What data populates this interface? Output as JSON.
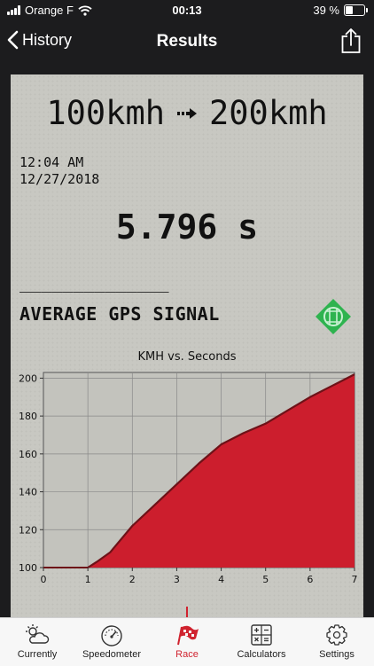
{
  "status_bar": {
    "carrier": "Orange F",
    "time": "00:13",
    "battery": "39 %"
  },
  "nav": {
    "back_label": "History",
    "title": "Results"
  },
  "result": {
    "speed_from": "100kmh",
    "speed_to": "200kmh",
    "time": "12:04 AM",
    "date": "12/27/2018",
    "elapsed": "5.796 s",
    "divider": "______________",
    "signal_label": "AVERAGE GPS SIGNAL"
  },
  "chart_data": {
    "type": "area",
    "title": "KMH vs. Seconds",
    "xlim": [
      0,
      7
    ],
    "ylim": [
      100,
      203
    ],
    "x_ticks": [
      0,
      1,
      2,
      3,
      4,
      5,
      6,
      7
    ],
    "y_ticks": [
      100,
      120,
      140,
      160,
      180,
      200
    ],
    "grid": true,
    "fill_color": "#cc1e2d",
    "line_color": "#6e1218",
    "x": [
      1.0,
      1.2,
      1.5,
      2.0,
      2.5,
      3.0,
      3.5,
      4.0,
      4.5,
      5.0,
      5.5,
      6.0,
      6.5,
      7.0
    ],
    "y": [
      100,
      103,
      108,
      122,
      133,
      144,
      155,
      165,
      171,
      176,
      183,
      190,
      196,
      202
    ]
  },
  "tabs": [
    {
      "label": "Currently",
      "icon": "weather-icon",
      "active": false
    },
    {
      "label": "Speedometer",
      "icon": "speedometer-icon",
      "active": false
    },
    {
      "label": "Race",
      "icon": "race-flag-icon",
      "active": true
    },
    {
      "label": "Calculators",
      "icon": "calculator-icon",
      "active": false
    },
    {
      "label": "Settings",
      "icon": "gear-icon",
      "active": false
    }
  ],
  "colors": {
    "accent": "#d0232f",
    "card_background": "#c8c8c2",
    "gps_badge": "#2eb34f"
  }
}
